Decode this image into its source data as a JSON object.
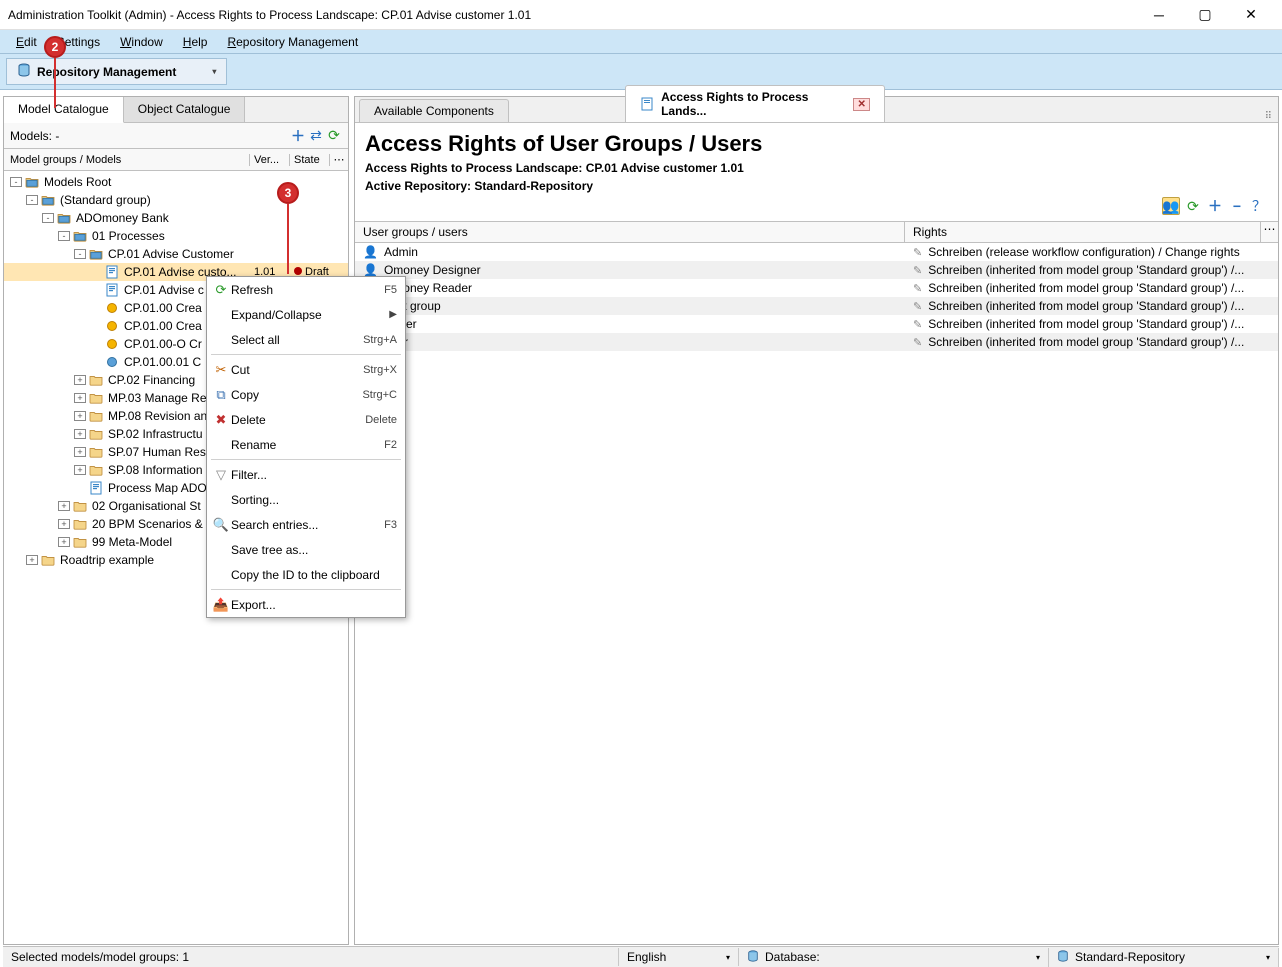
{
  "window": {
    "title": "Administration Toolkit (Admin) - Access Rights to Process Landscape: CP.01 Advise customer 1.01"
  },
  "menu": {
    "edit": "Edit",
    "settings": "Settings",
    "window": "Window",
    "help": "Help",
    "repo": "Repository Management"
  },
  "toolbar": {
    "repo_label": "Repository Management"
  },
  "left_tabs": {
    "model": "Model Catalogue",
    "object": "Object Catalogue"
  },
  "models_bar": {
    "label": "Models: -"
  },
  "tree_header": {
    "col1": "Model groups / Models",
    "col2": "Ver...",
    "col3": "State"
  },
  "tree": [
    {
      "depth": 0,
      "exp": "-",
      "ico": "folder-open",
      "txt": "Models Root"
    },
    {
      "depth": 1,
      "exp": "-",
      "ico": "folder-open",
      "txt": "(Standard group)"
    },
    {
      "depth": 2,
      "exp": "-",
      "ico": "folder-open",
      "txt": "ADOmoney Bank"
    },
    {
      "depth": 3,
      "exp": "-",
      "ico": "folder-open",
      "txt": "01 Processes"
    },
    {
      "depth": 4,
      "exp": "-",
      "ico": "folder-open",
      "txt": "CP.01 Advise Customer"
    },
    {
      "depth": 5,
      "exp": "",
      "ico": "model",
      "txt": "CP.01 Advise custo...",
      "ver": "1.01",
      "state": "Draft",
      "selected": true,
      "reddot": true
    },
    {
      "depth": 5,
      "exp": "",
      "ico": "model",
      "txt": "CP.01 Advise c"
    },
    {
      "depth": 5,
      "exp": "",
      "ico": "round-yel",
      "txt": "CP.01.00 Crea"
    },
    {
      "depth": 5,
      "exp": "",
      "ico": "round-yel",
      "txt": "CP.01.00 Crea"
    },
    {
      "depth": 5,
      "exp": "",
      "ico": "round-yel",
      "txt": "CP.01.00-O Cr"
    },
    {
      "depth": 5,
      "exp": "",
      "ico": "round-blue",
      "txt": "CP.01.00.01 C"
    },
    {
      "depth": 4,
      "exp": "+",
      "ico": "folder-closed",
      "txt": "CP.02 Financing"
    },
    {
      "depth": 4,
      "exp": "+",
      "ico": "folder-closed",
      "txt": "MP.03 Manage Re"
    },
    {
      "depth": 4,
      "exp": "+",
      "ico": "folder-closed",
      "txt": "MP.08 Revision an"
    },
    {
      "depth": 4,
      "exp": "+",
      "ico": "folder-closed",
      "txt": "SP.02 Infrastructu"
    },
    {
      "depth": 4,
      "exp": "+",
      "ico": "folder-closed",
      "txt": "SP.07 Human Res"
    },
    {
      "depth": 4,
      "exp": "+",
      "ico": "folder-closed",
      "txt": "SP.08 Information"
    },
    {
      "depth": 4,
      "exp": "",
      "ico": "model",
      "txt": "Process Map ADO"
    },
    {
      "depth": 3,
      "exp": "+",
      "ico": "folder-closed",
      "txt": "02 Organisational St"
    },
    {
      "depth": 3,
      "exp": "+",
      "ico": "folder-closed",
      "txt": "20 BPM Scenarios &"
    },
    {
      "depth": 3,
      "exp": "+",
      "ico": "folder-closed",
      "txt": "99 Meta-Model"
    },
    {
      "depth": 1,
      "exp": "+",
      "ico": "folder-closed",
      "txt": "Roadtrip example"
    }
  ],
  "context_menu": [
    {
      "icon": "refresh",
      "label": "Refresh",
      "key": "F5"
    },
    {
      "icon": "",
      "label": "Expand/Collapse",
      "arrow": true
    },
    {
      "icon": "",
      "label": "Select all",
      "key": "Strg+A"
    },
    {
      "sep": true
    },
    {
      "icon": "cut",
      "label": "Cut",
      "key": "Strg+X"
    },
    {
      "icon": "copy",
      "label": "Copy",
      "key": "Strg+C"
    },
    {
      "icon": "delete",
      "label": "Delete",
      "key": "Delete"
    },
    {
      "icon": "",
      "label": "Rename",
      "key": "F2"
    },
    {
      "sep": true
    },
    {
      "icon": "filter",
      "label": "Filter..."
    },
    {
      "icon": "",
      "label": "Sorting..."
    },
    {
      "icon": "search",
      "label": "Search entries...",
      "key": "F3"
    },
    {
      "icon": "",
      "label": "Save tree as..."
    },
    {
      "icon": "",
      "label": "Copy the ID to the clipboard"
    },
    {
      "sep": true
    },
    {
      "icon": "export",
      "label": "Export..."
    }
  ],
  "right_tabs": {
    "avail": "Available Components",
    "access": "Access Rights to Process Lands..."
  },
  "right_body": {
    "title": "Access Rights of User Groups / Users",
    "sub1": "Access Rights to Process Landscape: CP.01 Advise customer 1.01",
    "sub2": "Active Repository: Standard-Repository"
  },
  "rights_header": {
    "c1": "User groups / users",
    "c2": "Rights"
  },
  "rights_rows": [
    {
      "user": "Admin",
      "rights": "Schreiben (release workflow configuration) / Change rights"
    },
    {
      "user": "Omoney Designer",
      "rights": "Schreiben (inherited from model group 'Standard group') /..."
    },
    {
      "user": "Omoney Reader",
      "rights": "Schreiben (inherited from model group 'Standard group') /..."
    },
    {
      "user": "fault group",
      "rights": "Schreiben (inherited from model group 'Standard group') /..."
    },
    {
      "user": "signer",
      "rights": "Schreiben (inherited from model group 'Standard group') /..."
    },
    {
      "user": "ader",
      "rights": "Schreiben (inherited from model group 'Standard group') /..."
    }
  ],
  "statusbar": {
    "left": "Selected models/model groups: 1",
    "lang": "English",
    "db": "Database:",
    "repo": "Standard-Repository"
  },
  "badges": {
    "b2": "2",
    "b3": "3"
  }
}
